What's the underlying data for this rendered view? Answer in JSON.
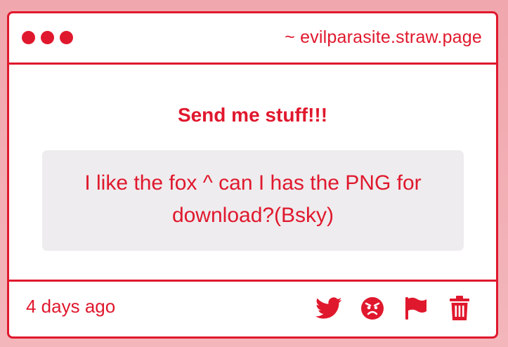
{
  "window": {
    "domain": "~ evilparasite.straw.page"
  },
  "main": {
    "prompt": "Send me stuff!!!",
    "message": "I like the fox ^ can I has the PNG for download?(Bsky)"
  },
  "footer": {
    "timestamp": "4 days ago",
    "actions": [
      {
        "icon": "twitter-icon"
      },
      {
        "icon": "angry-face-icon"
      },
      {
        "icon": "flag-icon"
      },
      {
        "icon": "trash-icon"
      }
    ]
  },
  "colors": {
    "accent": "#e0182d",
    "background": "#f3b6bb",
    "message_bg": "#eeecee"
  }
}
